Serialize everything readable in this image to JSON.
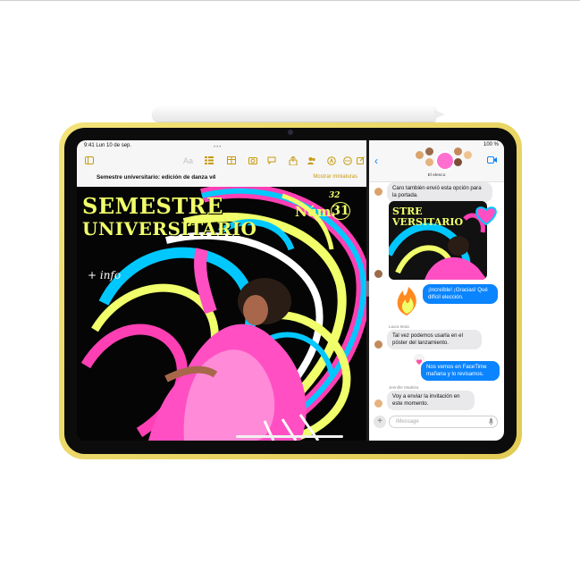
{
  "status_left": "9:41  Lun 10 de sep.",
  "status_right": "100 %",
  "pages": {
    "toolbar_icons": [
      "sidebar-icon",
      "text-format-icon",
      "list-icon",
      "table-icon",
      "media-icon",
      "comment-icon",
      "share-icon",
      "collab-icon",
      "pen-icon",
      "more-icon",
      "compose-icon"
    ],
    "toolbar_text_label": "Aa",
    "doc_title": "Semestre universitario: edición de danza v4",
    "doc_right": "Mostrar miniaturas",
    "poster_line1": "SEMESTRE",
    "poster_line2": "UNIVERSITARIO",
    "num_label": "Núm.",
    "num_small": "32",
    "num_big": "31",
    "handnote": "+ info"
  },
  "messages": {
    "group_name": "El elenco",
    "thumb_title_1": "STRE",
    "thumb_title_2": "VERSITARIO",
    "bubble_1": "Caro también envió esta opción para la portada.",
    "bubble_2": "¡Increíble! ¡Gracias! Qué difícil elección.",
    "sender_1": "Laura Mota",
    "bubble_3": "Tal vez podemos usarla en el póster del lanzamiento.",
    "bubble_4": "Nos vemos en FaceTime mañana y lo revisamos.",
    "sender_2": "Jennifer Madeira",
    "bubble_5": "Voy a enviar la invitación en este momento.",
    "compose_placeholder": "iMessage"
  },
  "colors": {
    "device_yellow": "#ecd86a",
    "accent_gold": "#c79a10",
    "imessage_blue": "#0a84ff",
    "poster_yellow": "#f0ff6a",
    "poster_pink": "#ff3fb4"
  }
}
